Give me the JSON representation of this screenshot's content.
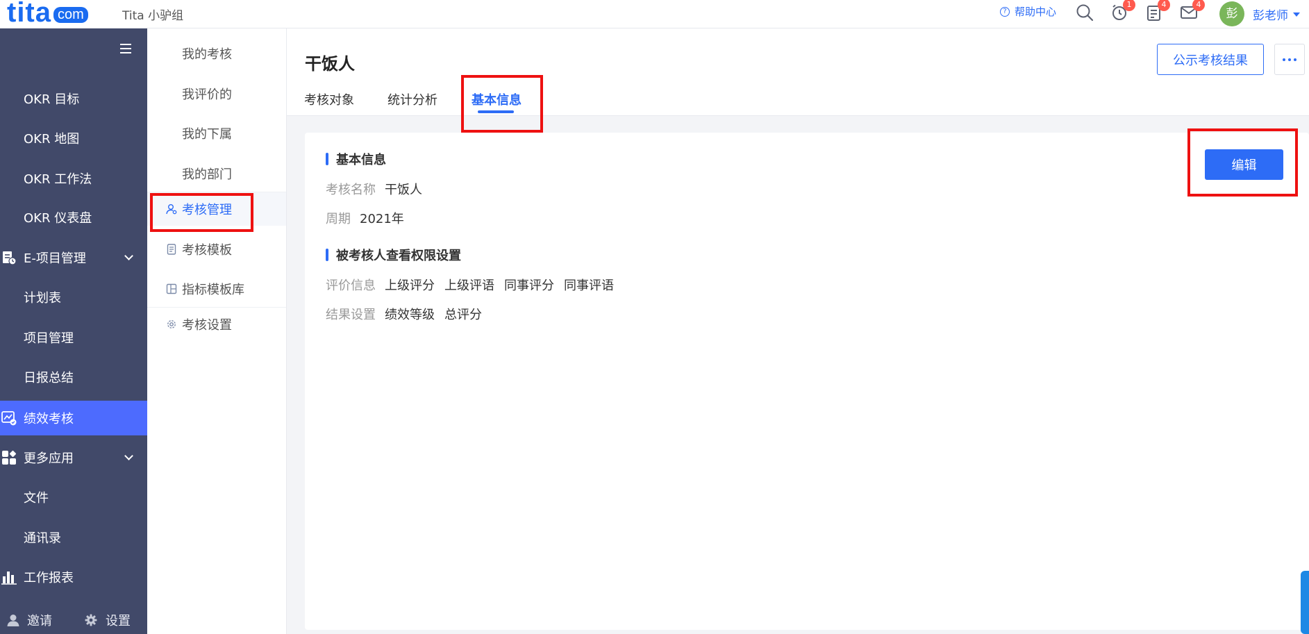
{
  "topbar": {
    "logo_main": "tita",
    "logo_com": "com",
    "org_name": "Tita 小驴组",
    "help_label": "帮助中心",
    "help_icon": "?",
    "badges": {
      "reminder": "1",
      "tasks": "4",
      "mail": "4"
    },
    "avatar_char": "彭",
    "user_name": "彭老师"
  },
  "leftnav": {
    "items": [
      {
        "label": "OKR 目标"
      },
      {
        "label": "OKR 地图"
      },
      {
        "label": "OKR 工作法"
      },
      {
        "label": "OKR 仪表盘"
      },
      {
        "label": "E-项目管理"
      },
      {
        "label": "计划表"
      },
      {
        "label": "项目管理"
      },
      {
        "label": "日报总结"
      },
      {
        "label": "绩效考核"
      },
      {
        "label": "更多应用"
      },
      {
        "label": "文件"
      },
      {
        "label": "通讯录"
      },
      {
        "label": "工作报表"
      }
    ],
    "invite_label": "邀请",
    "settings_label": "设置"
  },
  "submenu": {
    "items": [
      {
        "label": "我的考核"
      },
      {
        "label": "我评价的"
      },
      {
        "label": "我的下属"
      },
      {
        "label": "我的部门"
      },
      {
        "label": "考核管理"
      },
      {
        "label": "考核模板"
      },
      {
        "label": "指标模板库"
      },
      {
        "label": "考核设置"
      }
    ]
  },
  "main": {
    "title": "干饭人",
    "tabs": [
      {
        "label": "考核对象"
      },
      {
        "label": "统计分析"
      },
      {
        "label": "基本信息"
      }
    ],
    "publish_button": "公示考核结果",
    "edit_button": "编辑"
  },
  "card": {
    "section1_title": "基本信息",
    "name_label": "考核名称",
    "name_value": "干饭人",
    "period_label": "周期",
    "period_value": "2021年",
    "section2_title": "被考核人查看权限设置",
    "eval_label": "评价信息",
    "eval_values": [
      "上级评分",
      "上级评语",
      "同事评分",
      "同事评语"
    ],
    "result_label": "结果设置",
    "result_values": [
      "绩效等级",
      "总评分"
    ]
  },
  "colors": {
    "accent": "#2d6cf6",
    "sidebar": "#414969",
    "sidebar_active": "#4d6bfe",
    "highlight": "#ee1111"
  }
}
